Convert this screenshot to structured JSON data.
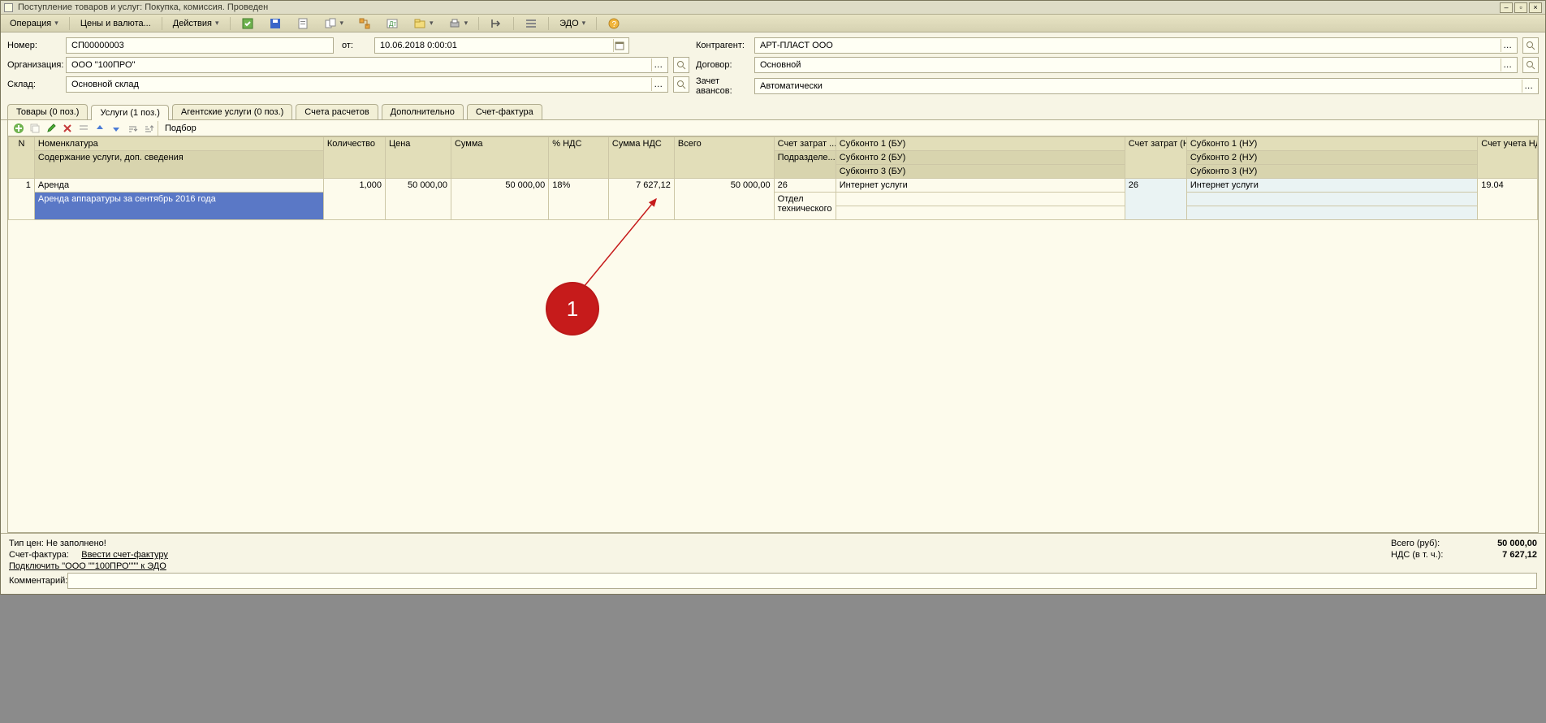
{
  "titlebar": {
    "title": "Поступление товаров и услуг: Покупка, комиссия. Проведен"
  },
  "toolbar": {
    "operation": "Операция",
    "prices": "Цены и валюта...",
    "actions": "Действия",
    "edo": "ЭДО"
  },
  "form": {
    "labels": {
      "number": "Номер:",
      "from": "от:",
      "org": "Организация:",
      "warehouse": "Склад:",
      "partner": "Контрагент:",
      "contract": "Договор:",
      "advance": "Зачет авансов:"
    },
    "number": "СП00000003",
    "date": "10.06.2018 0:00:01",
    "org": "ООО \"100ПРО\"",
    "warehouse": "Основной склад",
    "partner": "АРТ-ПЛАСТ ООО",
    "contract": "Основной",
    "advance": "Автоматически"
  },
  "tabs": [
    "Товары (0 поз.)",
    "Услуги (1 поз.)",
    "Агентские услуги (0 поз.)",
    "Счета расчетов",
    "Дополнительно",
    "Счет-фактура"
  ],
  "activeTab": 1,
  "gridToolbar": {
    "select": "Подбор"
  },
  "gridHeaders": {
    "n": "N",
    "nom": "Номенклатура",
    "nom_sub": "Содержание услуги, доп. сведения",
    "qty": "Количество",
    "price": "Цена",
    "sum": "Сумма",
    "vatp": "% НДС",
    "vatsum": "Сумма НДС",
    "total": "Всего",
    "acc1": "Счет затрат ...",
    "acc1_sub": "Подразделе... затрат",
    "sub1bu": "Субконто 1 (БУ)",
    "sub2bu": "Субконто 2 (БУ)",
    "sub3bu": "Субконто 3 (БУ)",
    "acc2": "Счет затрат (НУ)",
    "sub1nu": "Субконто 1 (НУ)",
    "sub2nu": "Субконто 2 (НУ)",
    "sub3nu": "Субконто 3 (НУ)",
    "vatacc": "Счет учета НДС"
  },
  "rows": [
    {
      "n": "1",
      "nom": "Аренда",
      "nom_sub": "Аренда аппаратуры за сентябрь 2016 года",
      "qty": "1,000",
      "price": "50 000,00",
      "sum": "50 000,00",
      "vatp": "18%",
      "vatsum": "7 627,12",
      "total": "50 000,00",
      "acc1": "26",
      "acc1_sub": "Отдел технического",
      "sub1bu": "Интернет услуги",
      "sub2bu": "",
      "sub3bu": "",
      "acc2": "26",
      "sub1nu": "Интернет услуги",
      "sub2nu": "",
      "sub3nu": "",
      "vatacc": "19.04"
    }
  ],
  "footer": {
    "priceType": "Тип цен: Не заполнено!",
    "invoiceLabel": "Счет-фактура:",
    "invoiceLink": "Ввести счет-фактуру",
    "edoLink": "Подключить \"ООО \"\"100ПРО\"\"\" к ЭДО",
    "commentLabel": "Комментарий:",
    "comment": "",
    "totals": {
      "totalLabel": "Всего (руб):",
      "totalVal": "50 000,00",
      "vatLabel": "НДС (в т. ч.):",
      "vatVal": "7 627,12"
    }
  },
  "annotation": {
    "number": "1"
  }
}
